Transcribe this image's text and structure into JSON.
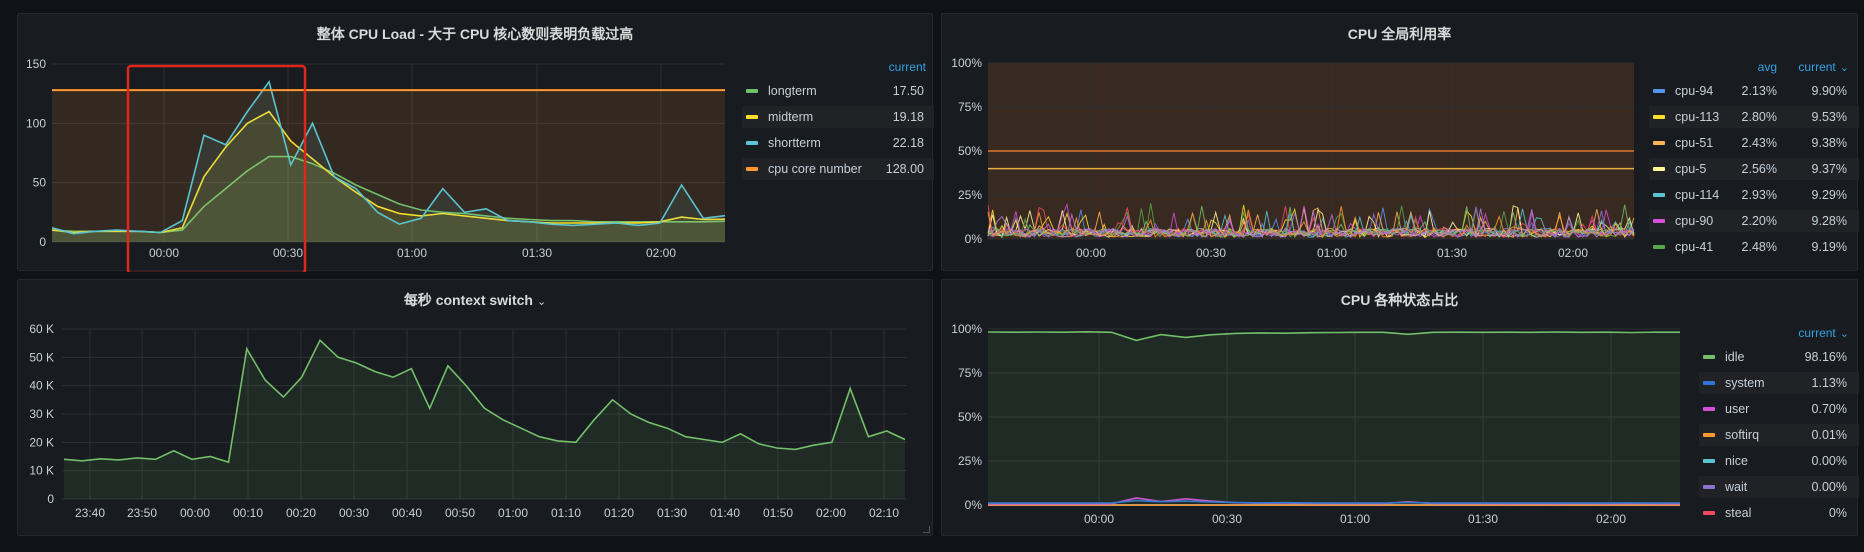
{
  "panels": {
    "load": {
      "title": "整体 CPU Load - 大于 CPU 核心数则表明负载过高",
      "legend_header": "current"
    },
    "util": {
      "title": "CPU 全局利用率",
      "legend_header_avg": "avg",
      "legend_header_current": "current"
    },
    "ctx": {
      "title": "每秒 context switch"
    },
    "state": {
      "title": "CPU 各种状态占比",
      "legend_header": "current"
    }
  },
  "chart_data": [
    {
      "type": "line",
      "title": "整体 CPU Load - 大于 CPU 核心数则表明负载过高",
      "ylim": [
        0,
        150
      ],
      "yticks": [
        "0",
        "50",
        "100",
        "150"
      ],
      "xticks": [
        "00:00",
        "00:30",
        "01:00",
        "01:30",
        "02:00"
      ],
      "x": [
        "23:35",
        "23:40",
        "23:45",
        "23:50",
        "23:55",
        "00:00",
        "00:05",
        "00:10",
        "00:15",
        "00:20",
        "00:25",
        "00:30",
        "00:35",
        "00:40",
        "00:45",
        "00:50",
        "00:55",
        "01:00",
        "01:05",
        "01:10",
        "01:15",
        "01:20",
        "01:25",
        "01:30",
        "01:35",
        "01:40",
        "01:45",
        "01:50",
        "01:55",
        "02:00",
        "02:05",
        "02:10"
      ],
      "series": [
        {
          "name": "longterm",
          "color": "#73bf69",
          "current": "17.50",
          "values": [
            10,
            9,
            9,
            9,
            9,
            8,
            10,
            30,
            45,
            60,
            72,
            72,
            66,
            58,
            48,
            40,
            32,
            27,
            25,
            24,
            22,
            20,
            19,
            18,
            18,
            17,
            17,
            17,
            17,
            17,
            17,
            17.5
          ]
        },
        {
          "name": "midterm",
          "color": "#fade2a",
          "current": "19.18",
          "values": [
            10,
            8,
            9,
            9,
            9,
            8,
            12,
            55,
            80,
            100,
            110,
            85,
            70,
            55,
            42,
            30,
            24,
            22,
            24,
            22,
            20,
            18,
            17,
            16,
            16,
            16,
            16,
            16,
            17,
            21,
            19,
            19.18
          ]
        },
        {
          "name": "shortterm",
          "color": "#5ac4d0",
          "current": "22.18",
          "values": [
            12,
            7,
            9,
            10,
            9,
            8,
            18,
            90,
            82,
            110,
            135,
            65,
            100,
            55,
            45,
            25,
            15,
            20,
            45,
            25,
            28,
            18,
            17,
            15,
            14,
            15,
            16,
            14,
            16,
            48,
            20,
            22.18
          ]
        },
        {
          "name": "cpu core number",
          "color": "#ff9830",
          "current": "128.00",
          "values": [
            128,
            128,
            128,
            128,
            128,
            128,
            128,
            128,
            128,
            128,
            128,
            128,
            128,
            128,
            128,
            128,
            128,
            128,
            128,
            128,
            128,
            128,
            128,
            128,
            128,
            128,
            128,
            128,
            128,
            128,
            128,
            128
          ]
        }
      ],
      "highlight_box": {
        "from": "23:55",
        "to": "00:33"
      }
    },
    {
      "type": "line",
      "title": "CPU 全局利用率",
      "ylim": [
        0,
        100
      ],
      "yticks": [
        "0%",
        "25%",
        "50%",
        "75%",
        "100%"
      ],
      "xticks": [
        "00:00",
        "00:30",
        "01:00",
        "01:30",
        "02:00"
      ],
      "thresholds": [
        {
          "value": 50,
          "color": "#e0752d"
        },
        {
          "value": 40,
          "color": "#e8b03c"
        }
      ],
      "series": [
        {
          "name": "cpu-94",
          "color": "#5794f2",
          "avg": "2.13%",
          "current": "9.90%"
        },
        {
          "name": "cpu-113",
          "color": "#fade2a",
          "avg": "2.80%",
          "current": "9.53%"
        },
        {
          "name": "cpu-51",
          "color": "#ffb357",
          "avg": "2.43%",
          "current": "9.38%"
        },
        {
          "name": "cpu-5",
          "color": "#fff899",
          "avg": "2.56%",
          "current": "9.37%"
        },
        {
          "name": "cpu-114",
          "color": "#5ac4d0",
          "avg": "2.93%",
          "current": "9.29%"
        },
        {
          "name": "cpu-90",
          "color": "#d64fd8",
          "avg": "2.20%",
          "current": "9.28%"
        },
        {
          "name": "cpu-41",
          "color": "#56a64b",
          "avg": "2.48%",
          "current": "9.19%"
        }
      ]
    },
    {
      "type": "area",
      "title": "每秒 context switch",
      "ylim": [
        0,
        60000
      ],
      "yticks": [
        "0",
        "10 K",
        "20 K",
        "30 K",
        "40 K",
        "50 K",
        "60 K"
      ],
      "xticks": [
        "23:40",
        "23:50",
        "00:00",
        "00:10",
        "00:20",
        "00:30",
        "00:40",
        "00:50",
        "01:00",
        "01:10",
        "01:20",
        "01:30",
        "01:40",
        "01:50",
        "02:00",
        "02:10"
      ],
      "series": [
        {
          "name": "context switch",
          "color": "#73bf69",
          "values": [
            14000,
            13500,
            14200,
            13800,
            14500,
            14000,
            17000,
            14000,
            15000,
            13000,
            53000,
            42000,
            36000,
            43000,
            56000,
            50000,
            48000,
            45000,
            43000,
            46000,
            32000,
            47000,
            40000,
            32000,
            28000,
            25000,
            22000,
            20500,
            20000,
            28000,
            35000,
            30000,
            27000,
            25000,
            22000,
            21000,
            20000,
            23000,
            19500,
            18000,
            17500,
            19000,
            20000,
            39000,
            22000,
            24000,
            21000
          ]
        }
      ]
    },
    {
      "type": "line",
      "title": "CPU 各种状态占比",
      "ylim": [
        0,
        100
      ],
      "yticks": [
        "0%",
        "25%",
        "50%",
        "75%",
        "100%"
      ],
      "xticks": [
        "00:00",
        "00:30",
        "01:00",
        "01:30",
        "02:00"
      ],
      "series": [
        {
          "name": "idle",
          "color": "#73bf69",
          "current": "98.16%",
          "values": [
            98.3,
            98.2,
            98.3,
            98.2,
            98.4,
            98.1,
            93.5,
            96.8,
            95.2,
            96.7,
            97.5,
            97.8,
            97.6,
            97.9,
            98.0,
            98.1,
            98.1,
            97.0,
            98.1,
            98.2,
            98.1,
            98.2,
            98.1,
            98.3,
            98.1,
            98.2,
            98.0,
            98.2,
            98.16
          ]
        },
        {
          "name": "system",
          "color": "#3274d9",
          "current": "1.13%",
          "values": [
            1.1,
            1.1,
            1.1,
            1.1,
            1.1,
            1.2,
            2.5,
            1.9,
            2.2,
            1.7,
            1.4,
            1.2,
            1.3,
            1.2,
            1.1,
            1.1,
            1.1,
            1.4,
            1.1,
            1.1,
            1.1,
            1.1,
            1.1,
            1.1,
            1.1,
            1.1,
            1.2,
            1.1,
            1.13
          ]
        },
        {
          "name": "user",
          "color": "#d64fd8",
          "current": "0.70%",
          "values": [
            0.6,
            0.6,
            0.6,
            0.6,
            0.6,
            0.7,
            4.0,
            2.0,
            3.5,
            2.2,
            1.3,
            1.0,
            1.1,
            0.9,
            0.8,
            0.8,
            0.8,
            1.8,
            0.8,
            0.8,
            0.8,
            0.7,
            0.8,
            0.7,
            0.8,
            0.7,
            0.9,
            0.7,
            0.7
          ]
        },
        {
          "name": "softirq",
          "color": "#ff9830",
          "current": "0.01%",
          "values": [
            0.01,
            0.01,
            0.01,
            0.01,
            0.01,
            0.01,
            0.01,
            0.01,
            0.01,
            0.01,
            0.01,
            0.01,
            0.01,
            0.01,
            0.01,
            0.01,
            0.01,
            0.01,
            0.01,
            0.01,
            0.01,
            0.01,
            0.01,
            0.01,
            0.01,
            0.01,
            0.01,
            0.01,
            0.01
          ]
        },
        {
          "name": "nice",
          "color": "#5ac4d0",
          "current": "0.00%",
          "values": [
            0,
            0,
            0,
            0,
            0,
            0,
            0,
            0,
            0,
            0,
            0,
            0,
            0,
            0,
            0,
            0,
            0,
            0,
            0,
            0,
            0,
            0,
            0,
            0,
            0,
            0,
            0,
            0,
            0
          ]
        },
        {
          "name": "wait",
          "color": "#8f6fd0",
          "current": "0.00%",
          "values": [
            0,
            0,
            0,
            0,
            0,
            0,
            0,
            0,
            0,
            0,
            0,
            0,
            0,
            0,
            0,
            0,
            0,
            0,
            0,
            0,
            0,
            0,
            0,
            0,
            0,
            0,
            0,
            0,
            0
          ]
        },
        {
          "name": "steal",
          "color": "#f2495c",
          "current": "0%",
          "values": [
            0,
            0,
            0,
            0,
            0,
            0,
            0,
            0,
            0,
            0,
            0,
            0,
            0,
            0,
            0,
            0,
            0,
            0,
            0,
            0,
            0,
            0,
            0,
            0,
            0,
            0,
            0,
            0,
            0
          ]
        }
      ]
    }
  ]
}
